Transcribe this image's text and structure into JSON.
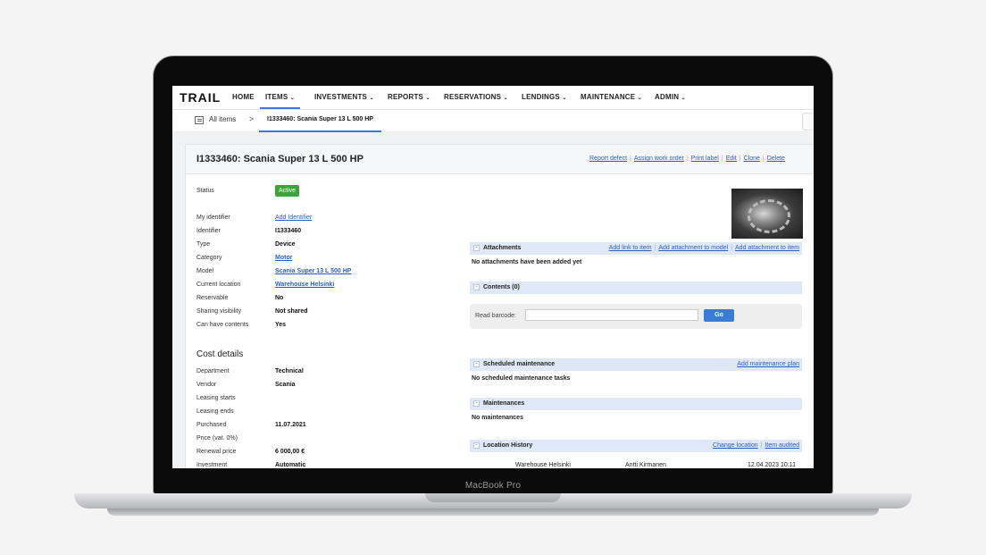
{
  "device": {
    "brand": "MacBook Pro"
  },
  "nav": {
    "logo": "TRAIL",
    "items": [
      {
        "label": "HOME"
      },
      {
        "label": "ITEMS"
      },
      {
        "label": "INVESTMENTS"
      },
      {
        "label": "REPORTS"
      },
      {
        "label": "RESERVATIONS"
      },
      {
        "label": "LENDINGS"
      },
      {
        "label": "MAINTENANCE"
      },
      {
        "label": "ADMIN"
      }
    ],
    "active": "ITEMS",
    "chevron": "⌄"
  },
  "breadcrumb": {
    "all": "All items",
    "separator": ">",
    "current": "I1333460: Scania Super 13 L 500 HP"
  },
  "item": {
    "title": "I1333460: Scania Super 13 L 500 HP",
    "actions": [
      "Report defect",
      "Assign work order",
      "Print label",
      "Edit",
      "Clone",
      "Delete"
    ],
    "status_label": "Status",
    "status": "Active",
    "fields": [
      {
        "label": "My identifier",
        "value": "Add Identifier"
      },
      {
        "label": "Identifier",
        "value": "I1333460"
      },
      {
        "label": "Type",
        "value": "Device"
      },
      {
        "label": "Category",
        "value": "Motor"
      },
      {
        "label": "Model",
        "value": "Scania Super 13 L 500 HP"
      },
      {
        "label": "Current location",
        "value": "Warehouse Helsinki"
      },
      {
        "label": "Reservable",
        "value": "No"
      },
      {
        "label": "Sharing visibility",
        "value": "Not shared"
      },
      {
        "label": "Can have contents",
        "value": "Yes"
      }
    ]
  },
  "cost": {
    "heading": "Cost details",
    "fields": [
      {
        "label": "Department",
        "value": "Technical"
      },
      {
        "label": "Vendor",
        "value": "Scania"
      },
      {
        "label": "Leasing starts",
        "value": ""
      },
      {
        "label": "Leasing ends",
        "value": ""
      },
      {
        "label": "Purchased",
        "value": "11.07.2021"
      },
      {
        "label": "Price (vat. 0%)",
        "value": ""
      },
      {
        "label": "Renewal price",
        "value": "6 000,00 €"
      },
      {
        "label": "Investment",
        "value": "Automatic"
      }
    ]
  },
  "attachments": {
    "title": "Attachments",
    "links": [
      "Add link to item",
      "Add attachment to model",
      "Add attachment to item"
    ],
    "empty": "No attachments have been added yet"
  },
  "contents": {
    "title": "Contents (0)",
    "barcode_label": "Read barcode:",
    "go": "Go"
  },
  "scheduled": {
    "title": "Scheduled maintenance",
    "link": "Add maintenance plan",
    "empty": "No scheduled maintenance tasks"
  },
  "maintenances": {
    "title": "Maintenances",
    "empty": "No maintenances"
  },
  "location_history": {
    "title": "Location History",
    "links": [
      "Change location",
      "Item audited"
    ],
    "row": {
      "location": "Warehouse Helsinki",
      "user": "Antti Kirmanen",
      "time": "12.04.2023 10:11"
    }
  },
  "colors": {
    "accent": "#3a7bd5",
    "active_badge": "#3aa636",
    "link": "#2b5fbf",
    "section_bg": "#dfe8f6"
  }
}
